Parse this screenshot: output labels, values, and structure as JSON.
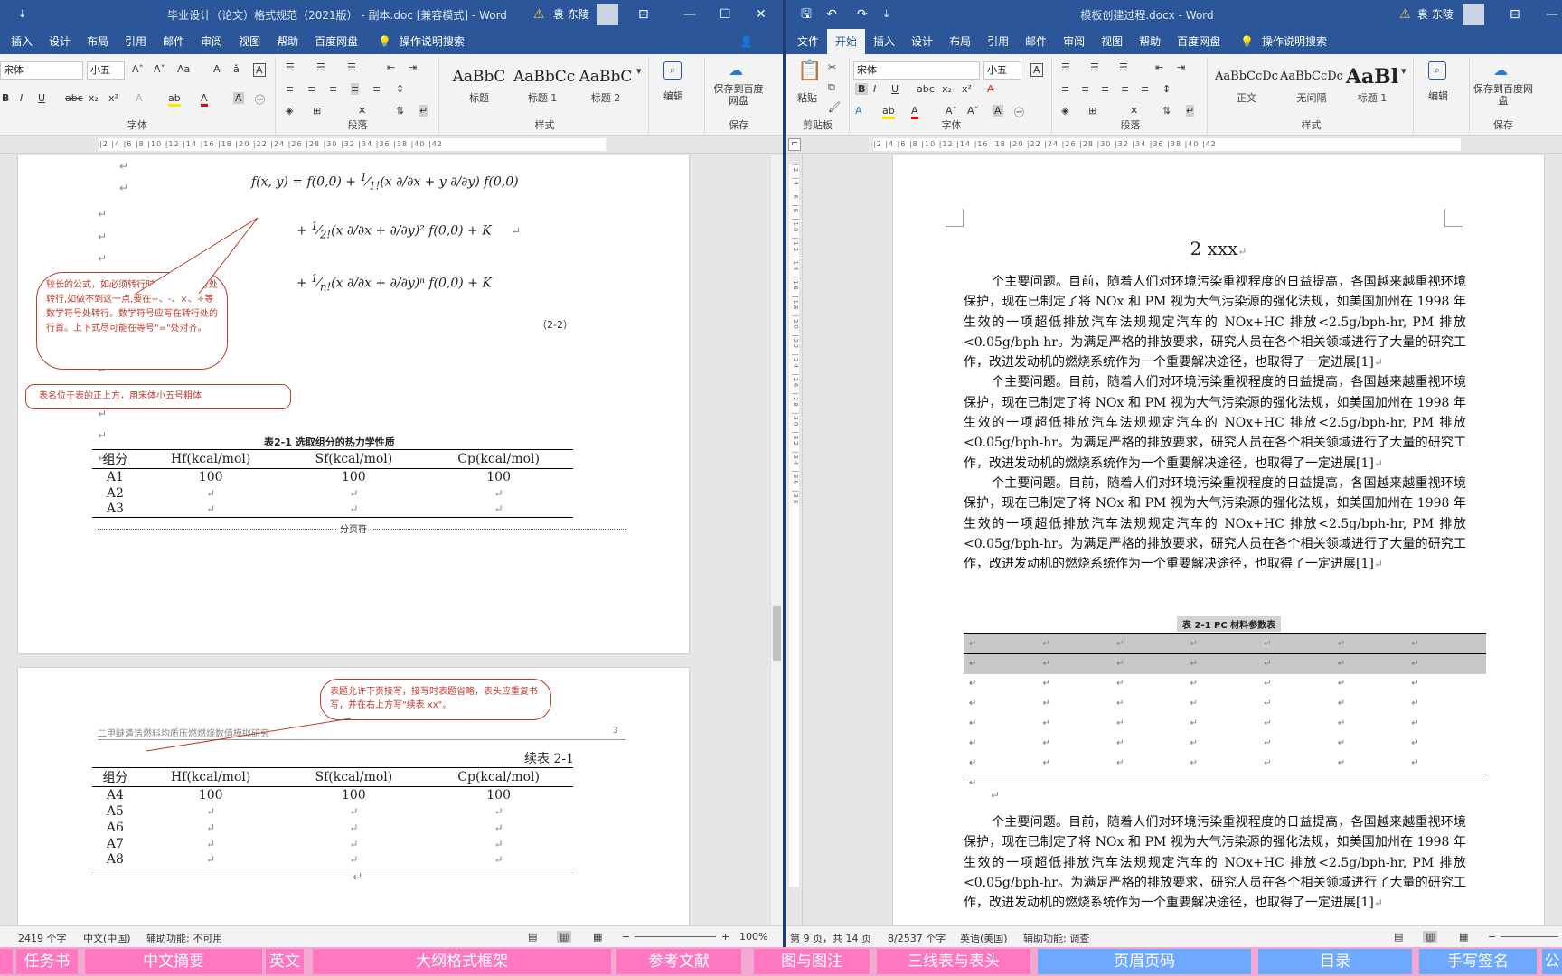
{
  "left": {
    "title": "毕业设计（论文）格式规范（2021版） - 副本.doc [兼容模式] - Word",
    "user": "袁 东陵",
    "tabs": [
      "插入",
      "设计",
      "布局",
      "引用",
      "邮件",
      "审阅",
      "视图",
      "帮助",
      "百度网盘"
    ],
    "tellme": "操作说明搜索",
    "share": "共享",
    "font_name": "宋体",
    "font_size": "小五",
    "styles": [
      {
        "preview": "AaBbC",
        "name": "标题"
      },
      {
        "preview": "AaBbCc",
        "name": "标题 1"
      },
      {
        "preview": "AaBbC",
        "name": "标题 2"
      }
    ],
    "group_labels": {
      "font": "字体",
      "para": "段落",
      "styles": "样式",
      "save": "保存"
    },
    "edit": "编辑",
    "save_btn": "保存到百度网盘",
    "formula_eqno": "（2-2）",
    "callout_formula": "较长的公式，如必须转行时，最好在等号处转行,如做不到这一点,要在+、-、×、÷等数学符号处转行。数学符号应写在转行处的行首。上下式尽可能在等号\"=\"处对齐。",
    "callout_table": "表名位于表的正上方，用宋体小五号粗体",
    "table_caption": "表2-1 选取组分的热力学性质",
    "table_headers": [
      "组分",
      "Hf(kcal/mol)",
      "Sf(kcal/mol)",
      "Cp(kcal/mol)"
    ],
    "table_rows": [
      [
        "A1",
        "100",
        "100",
        "100"
      ],
      [
        "A2",
        "",
        "",
        ""
      ],
      [
        "A3",
        "",
        "",
        ""
      ]
    ],
    "page_break": "分页符",
    "callout_continue": "表题允许下页接写，接写时表题省略，表头应重复书写，并在右上方写\"续表 xx\"。",
    "header_text": "二甲醚清洁燃料均质压燃燃烧数值模拟研究",
    "page_no": "3",
    "continue_label": "续表 2-1",
    "table2_rows": [
      [
        "A4",
        "100",
        "100",
        "100"
      ],
      [
        "A5",
        "",
        "",
        ""
      ],
      [
        "A6",
        "",
        "",
        ""
      ],
      [
        "A7",
        "",
        "",
        ""
      ],
      [
        "A8",
        "",
        "",
        ""
      ]
    ],
    "status_words": "2419 个字",
    "status_lang": "中文(中国)",
    "status_access": "辅助功能: 不可用",
    "zoom": "100%"
  },
  "right": {
    "title": "模板创建过程.docx - Word",
    "user": "袁 东陵",
    "tabs": [
      "文件",
      "开始",
      "插入",
      "设计",
      "布局",
      "引用",
      "邮件",
      "审阅",
      "视图",
      "帮助",
      "百度网盘"
    ],
    "active_tab": "开始",
    "tellme": "操作说明搜索",
    "font_name": "宋体",
    "font_size": "小五",
    "paste": "粘贴",
    "styles": [
      {
        "preview": "AaBbCcDc",
        "name": "正文"
      },
      {
        "preview": "AaBbCcDc",
        "name": "无间隔"
      },
      {
        "preview": "AaBl",
        "name": "标题 1"
      }
    ],
    "group_labels": {
      "clipboard": "剪贴板",
      "font": "字体",
      "para": "段落",
      "styles": "样式",
      "save": "保存"
    },
    "edit": "编辑",
    "save_btn": "保存到百度网盘",
    "heading": "2 xxx",
    "paragraph": "个主要问题。目前，随着人们对环境污染重视程度的日益提高，各国越来越重视环境保护，现在已制定了将 NOx 和 PM 视为大气污染源的强化法规，如美国加州在 1998 年生效的一项超低排放汽车法规规定汽车的 NOx+HC 排放<2.5g/bph-hr, PM 排放<0.05g/bph-hr。为满足严格的排放要求，研究人员在各个相关领域进行了大量的研究工作，改进发动机的燃烧系统作为一个重要解决途径，也取得了一定进展[1]",
    "table_caption": "表 2-1 PC 材料参数表",
    "status_page": "第 9 页，共 14 页",
    "status_words": "8/2537 个字",
    "status_lang": "英语(美国)",
    "status_access": "辅助功能: 调查"
  },
  "taskbar": [
    "任务书",
    "中文摘要",
    "英文",
    "大纲格式框架",
    "参考文献",
    "图与图注",
    "三线表与表头",
    "页眉页码",
    "目录",
    "手写签名",
    "公"
  ]
}
